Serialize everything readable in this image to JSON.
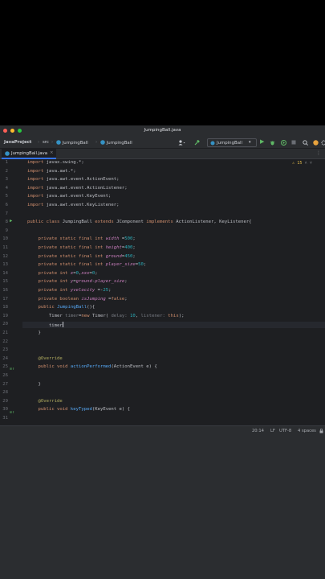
{
  "window": {
    "title": "JumpingBall.java"
  },
  "nav": {
    "project": "JavaProject",
    "src": "src",
    "file": "JumpingBall",
    "class": "JumpingBall",
    "run_config": "JumpingBall"
  },
  "tab": {
    "label": "JumpingBall.java"
  },
  "inspections": {
    "warnings": "15"
  },
  "editor": {
    "lines": [
      {
        "n": "1",
        "html": "<span class=\"kw\">import</span> javax.swing.*;"
      },
      {
        "n": "2",
        "html": "<span class=\"kw\">import</span> java.awt.*;"
      },
      {
        "n": "3",
        "html": "<span class=\"kw\">import</span> java.awt.event.ActionEvent;"
      },
      {
        "n": "4",
        "html": "<span class=\"kw\">import</span> java.awt.event.ActionListener;"
      },
      {
        "n": "5",
        "html": "<span class=\"kw\">import</span> java.awt.event.KeyEvent;"
      },
      {
        "n": "6",
        "html": "<span class=\"kw\">import</span> java.awt.event.KeyListener;"
      },
      {
        "n": "7",
        "html": ""
      },
      {
        "n": "8",
        "html": "<span class=\"kw\">public class</span> JumpingBall <span class=\"kw\">extends</span> JComponent <span class=\"kw\">implements</span> ActionListener, KeyListener{"
      },
      {
        "n": "9",
        "html": ""
      },
      {
        "n": "10",
        "html": "    <span class=\"kw\">private static final int</span> <span class=\"fld\">width</span> =<span class=\"num\">500</span>;"
      },
      {
        "n": "11",
        "html": "    <span class=\"kw\">private static final int</span> <span class=\"fld\">height</span>=<span class=\"num\">400</span>;"
      },
      {
        "n": "12",
        "html": "    <span class=\"kw\">private static final int</span> <span class=\"fld\">ground</span>=<span class=\"num\">450</span>;"
      },
      {
        "n": "13",
        "html": "    <span class=\"kw\">private static final int</span> <span class=\"fld\">player_size</span>=<span class=\"num\">50</span>;"
      },
      {
        "n": "14",
        "html": "    <span class=\"kw\">private int</span> <span class=\"fld\">x</span>=<span class=\"num\">0</span>,<span class=\"fld\">xxx</span>=<span class=\"num\">0</span>;"
      },
      {
        "n": "15",
        "html": "    <span class=\"kw\">private int</span> <span class=\"fld\">y</span>=<span class=\"fld\">ground</span>-<span class=\"fld\">player_size</span>;"
      },
      {
        "n": "16",
        "html": "    <span class=\"kw\">private int</span> <span class=\"fld\">yvelocity</span> =-<span class=\"num\">25</span>;"
      },
      {
        "n": "17",
        "html": "    <span class=\"kw\">private boolean</span> <span class=\"fld\">isJumping</span> =<span class=\"kw\">false</span>;"
      },
      {
        "n": "18",
        "html": "    <span class=\"kw\">public</span> <span class=\"fn\">JumpingBall</span>(){"
      },
      {
        "n": "19",
        "html": "        Timer <span class=\"unused\">timer</span>=<span class=\"kw\">new</span> Timer( <span class=\"hint\">delay:</span> <span class=\"num\">10</span>, <span class=\"hint\">listener:</span> <span class=\"kw\">this</span>);"
      },
      {
        "n": "20",
        "html": "        timer<span class=\"caret\"></span>"
      },
      {
        "n": "21",
        "html": "    }"
      },
      {
        "n": "22",
        "html": ""
      },
      {
        "n": "23",
        "html": ""
      },
      {
        "n": "24",
        "html": "    <span class=\"ann\">@Override</span>"
      },
      {
        "n": "25",
        "html": "    <span class=\"kw\">public void</span> <span class=\"fn\">actionPerformed</span>(ActionEvent e) {"
      },
      {
        "n": "26",
        "html": ""
      },
      {
        "n": "27",
        "html": "    }"
      },
      {
        "n": "28",
        "html": ""
      },
      {
        "n": "29",
        "html": "    <span class=\"ann\">@Override</span>"
      },
      {
        "n": "30",
        "html": "    <span class=\"kw\">public void</span> <span class=\"fn\">keyTyped</span>(KeyEvent e) {"
      },
      {
        "n": "31",
        "html": ""
      }
    ]
  },
  "status": {
    "position": "20:14",
    "line_sep": "LF",
    "encoding": "UTF-8",
    "indent": "4 spaces"
  },
  "colors": {
    "accent": "#3574f0",
    "run": "#5fb865"
  }
}
